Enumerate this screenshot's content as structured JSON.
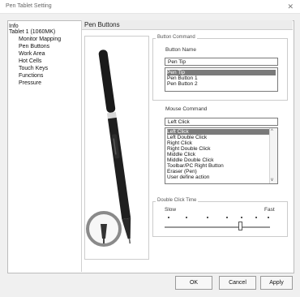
{
  "window": {
    "title": "Pen Tablet Setting",
    "close_glyph": "✕"
  },
  "nav": {
    "root": "Info",
    "device": "Tablet 1 (1060MK)",
    "items": [
      {
        "label": "Monitor Mapping"
      },
      {
        "label": "Pen Buttons"
      },
      {
        "label": "Work Area"
      },
      {
        "label": "Hot Cells"
      },
      {
        "label": "Touch Keys"
      },
      {
        "label": "Functions"
      },
      {
        "label": "Pressure"
      }
    ]
  },
  "section": {
    "title": "Pen Buttons"
  },
  "button_command": {
    "legend": "Button Command",
    "name_label": "Button Name",
    "name_value": "Pen Tip",
    "options": [
      "Pen Tip",
      "Pen Button 1",
      "Pen Button 2"
    ],
    "selected_index": 0
  },
  "mouse_command": {
    "label": "Mouse Command",
    "current_value": "Left Click",
    "options": [
      "Left Click",
      "Left Double Click",
      "Right Click",
      "Right Double Click",
      "Middle Click",
      "Middle Double Click",
      "Toolbar/PC Right Button",
      "Eraser (Pen)",
      "User define action"
    ],
    "selected_index": 0,
    "scroll_up_glyph": "^",
    "scroll_down_glyph": "v"
  },
  "double_click": {
    "legend": "Double Click Time",
    "slow_label": "Slow",
    "fast_label": "Fast",
    "value": 0.72
  },
  "buttons": {
    "ok": "OK",
    "cancel": "Cancel",
    "apply": "Apply"
  },
  "colors": {
    "selection": "#7a7a7a",
    "pen_body": "#1c1c1c",
    "pen_band": "#d8d8d8"
  },
  "icons": {
    "pen": "stylus-pen-icon",
    "magnifier": "magnifier-icon",
    "close": "close-icon"
  }
}
